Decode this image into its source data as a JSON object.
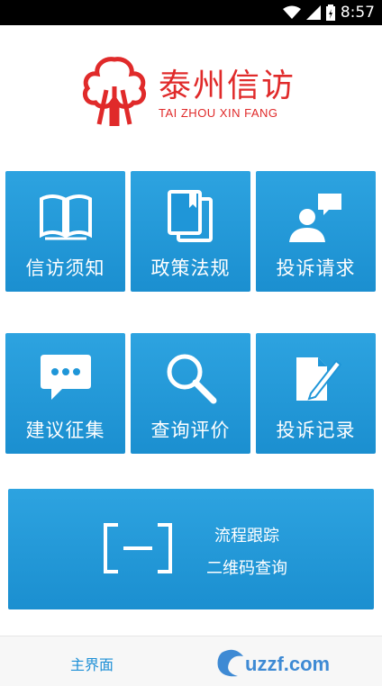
{
  "status_bar": {
    "time": "8:57",
    "icons": [
      "wifi-icon",
      "signal-icon",
      "battery-icon"
    ]
  },
  "logo": {
    "title": "泰州信访",
    "subtitle": "TAI ZHOU XIN FANG",
    "brand_color": "#e02a2a"
  },
  "tiles": [
    {
      "label": "信访须知",
      "icon": "book-icon"
    },
    {
      "label": "政策法规",
      "icon": "documents-icon"
    },
    {
      "label": "投诉请求",
      "icon": "person-chat-icon"
    },
    {
      "label": "建议征集",
      "icon": "chat-bubble-icon"
    },
    {
      "label": "查询评价",
      "icon": "search-icon"
    },
    {
      "label": "投诉记录",
      "icon": "edit-document-icon"
    }
  ],
  "wide_tile": {
    "line1": "流程跟踪",
    "line2": "二维码查询",
    "icon": "qr-scan-icon"
  },
  "tab_bar": {
    "main_label": "主界面"
  },
  "watermark": {
    "text": "uzzf.com"
  },
  "colors": {
    "tile_blue": "#1f96d8",
    "tab_active": "#1d8fd6"
  }
}
